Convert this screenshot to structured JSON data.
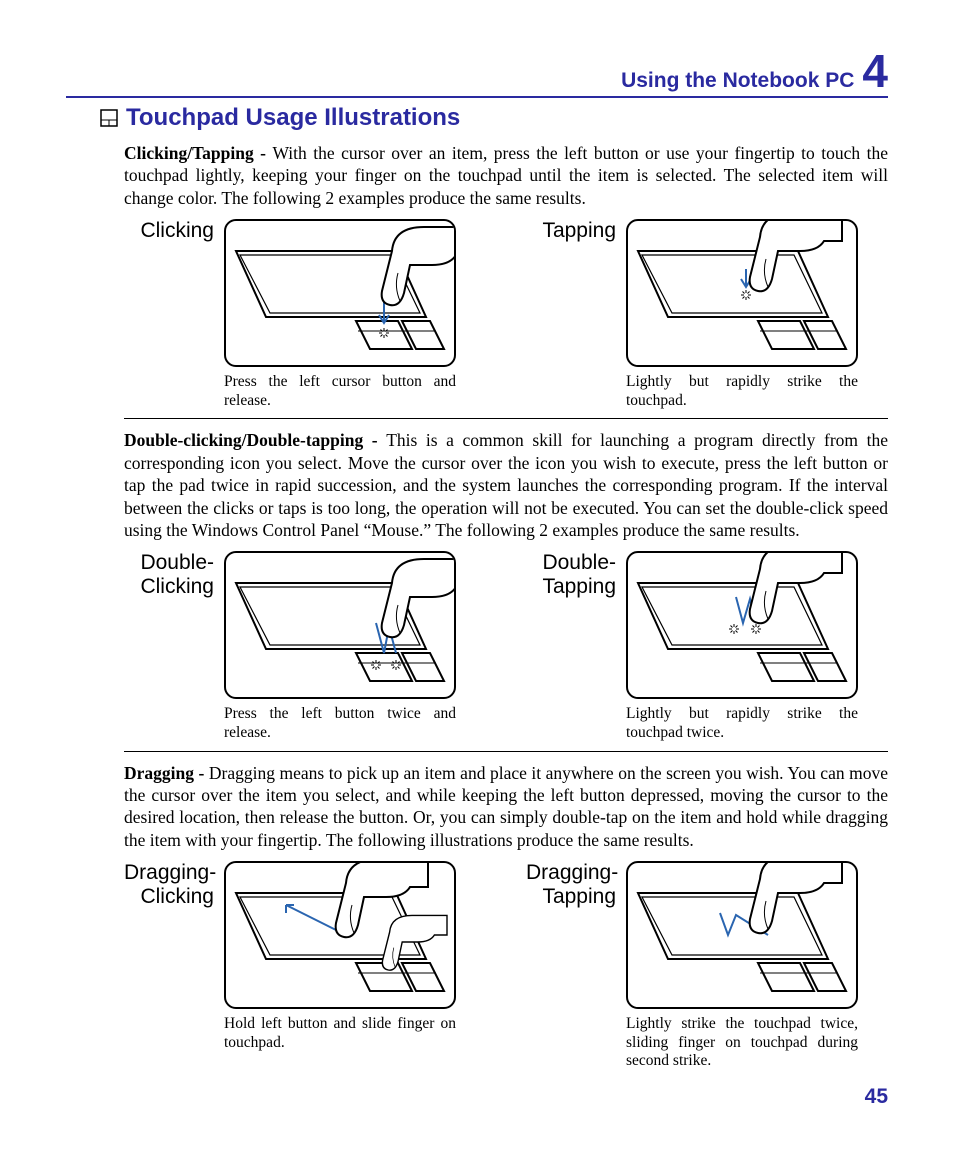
{
  "header": {
    "section": "Using the Notebook PC",
    "chapter_num": "4"
  },
  "title": "Touchpad Usage Illustrations",
  "para1_lead": "Clicking/Tapping - ",
  "para1_body": "With the cursor over an item, press the left button or use your fingertip to touch the touchpad lightly, keeping your finger on the touchpad until the item is selected. The selected item will change color. The following 2 examples produce the same results.",
  "row1": {
    "left": {
      "label": "Clicking",
      "caption": "Press the left cursor button and release."
    },
    "right": {
      "label": "Tapping",
      "caption": "Lightly but rapidly strike the touchpad."
    }
  },
  "para2_lead": "Double-clicking/Double-tapping - ",
  "para2_body": "This is a common skill for launching a program directly from the corresponding icon you select. Move the cursor over the icon you wish to execute, press the left button or tap the pad twice in rapid succession, and the system launches the corresponding program. If the interval between the clicks or taps is too long, the operation will not be executed. You can set the double-click speed using the Windows Control Panel “Mouse.” The following 2 examples produce the same results.",
  "row2": {
    "left": {
      "label": "Double-\nClicking",
      "caption": "Press the left button twice and release."
    },
    "right": {
      "label": "Double-\nTapping",
      "caption": "Lightly but rapidly strike the touchpad twice."
    }
  },
  "para3_lead": "Dragging - ",
  "para3_body": "Dragging means to pick up an item and place it anywhere on the screen you wish. You can move the cursor over the item you select, and while keeping the left button depressed, moving the cursor to the desired location, then release the button. Or, you can simply double-tap on the item and hold while dragging the item with your fingertip. The following illustrations produce the same results.",
  "row3": {
    "left": {
      "label": "Dragging-\nClicking",
      "caption": "Hold left button and slide finger on touchpad."
    },
    "right": {
      "label": "Dragging-\nTapping",
      "caption": "Lightly strike the touchpad twice, sliding finger on touchpad during second strike."
    }
  },
  "page_number": "45"
}
